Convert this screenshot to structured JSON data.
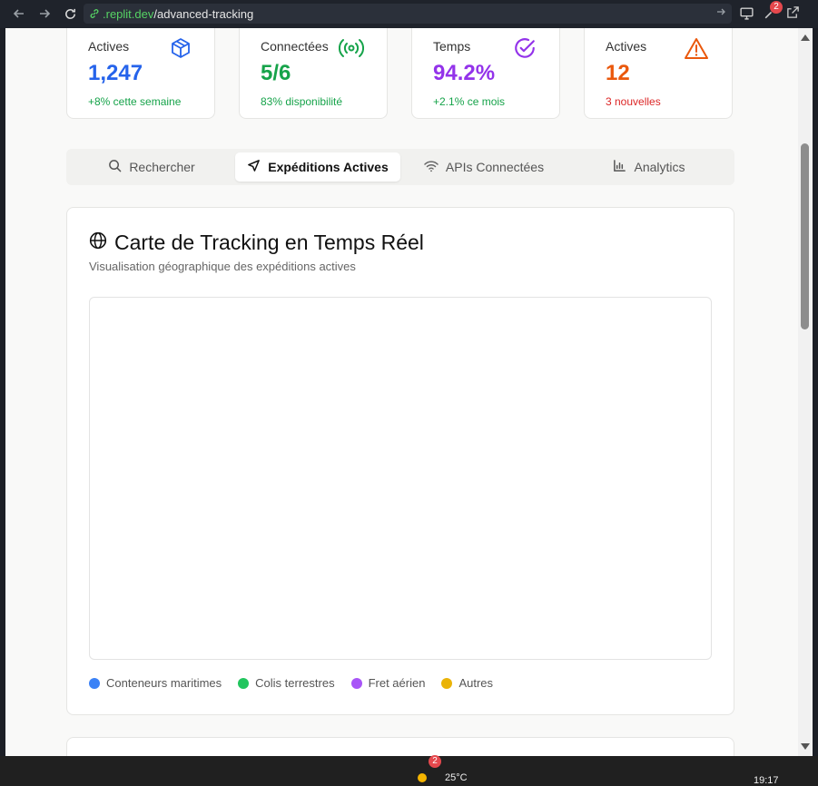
{
  "browser": {
    "url_domain": ".replit.dev",
    "url_path": "/advanced-tracking",
    "notification_count": "2"
  },
  "stats": [
    {
      "label": "Actives",
      "value": "1,247",
      "sub": "+8% cette semaine",
      "icon": "package-icon",
      "value_color": "#2563eb",
      "sub_color": "#16a34a"
    },
    {
      "label": "Connectées",
      "value": "5/6",
      "sub": "83% disponibilité",
      "icon": "radio-signal-icon",
      "value_color": "#16a34a",
      "sub_color": "#16a34a"
    },
    {
      "label": "Temps",
      "value": "94.2%",
      "sub": "+2.1% ce mois",
      "icon": "check-circle-icon",
      "value_color": "#9333ea",
      "sub_color": "#16a34a"
    },
    {
      "label": "Actives",
      "value": "12",
      "sub": "3 nouvelles",
      "icon": "warning-triangle-icon",
      "value_color": "#ea580c",
      "sub_color": "#dc2626"
    }
  ],
  "tabs": [
    {
      "label": "Rechercher",
      "icon": "search-icon",
      "active": false
    },
    {
      "label": "Expéditions Actives",
      "icon": "navigation-icon",
      "active": true
    },
    {
      "label": "APIs Connectées",
      "icon": "wifi-icon",
      "active": false
    },
    {
      "label": "Analytics",
      "icon": "bar-chart-icon",
      "active": false
    }
  ],
  "map": {
    "title": "Carte de Tracking en Temps Réel",
    "subtitle": "Visualisation géographique des expéditions actives",
    "legend": [
      {
        "label": "Conteneurs maritimes",
        "color": "#3b82f6"
      },
      {
        "label": "Colis terrestres",
        "color": "#22c55e"
      },
      {
        "label": "Fret aérien",
        "color": "#a855f7"
      },
      {
        "label": "Autres",
        "color": "#eab308"
      }
    ]
  },
  "taskbar": {
    "temperature": "25°C",
    "notification_count": "2",
    "time": "19:17"
  }
}
